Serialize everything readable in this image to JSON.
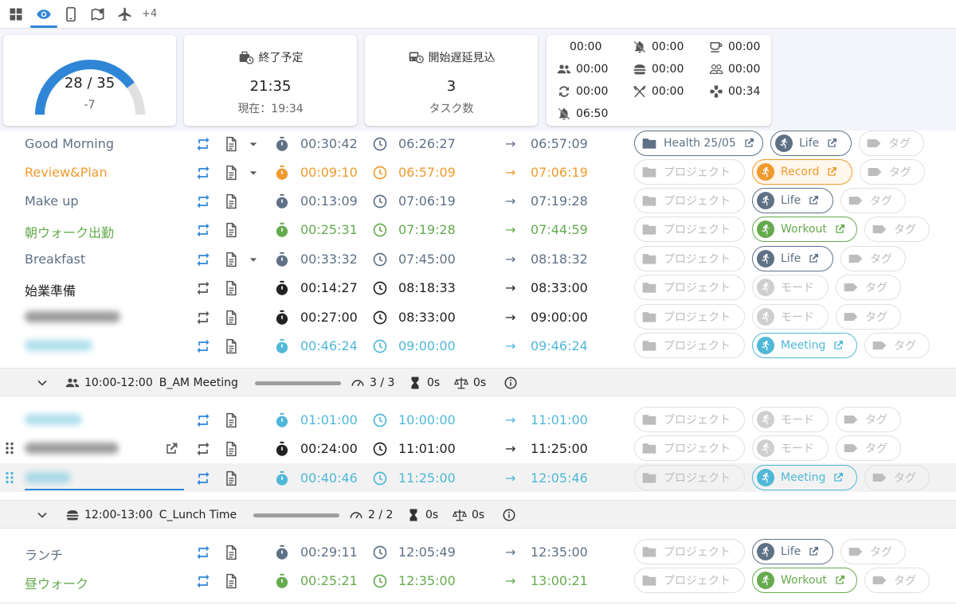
{
  "tabs": {
    "icons": [
      "grid-icon",
      "eye-icon",
      "phone-icon",
      "map-icon",
      "airplane-icon"
    ],
    "more_label": "+4"
  },
  "summary": {
    "gauge": {
      "main": "28 / 35",
      "sub": "-7",
      "progress": 0.8
    },
    "end_forecast": {
      "title": "終了予定",
      "value": "21:35",
      "sub": "現在：19:34"
    },
    "delay_forecast": {
      "title": "開始遅延見込",
      "value": "3",
      "sub": "タスク数"
    },
    "modes": [
      {
        "icon": "none",
        "value": "00:00"
      },
      {
        "icon": "notification-off-icon",
        "value": "00:00"
      },
      {
        "icon": "coffee-icon",
        "value": "00:00"
      },
      {
        "icon": "people-icon",
        "value": "00:00"
      },
      {
        "icon": "burger-icon",
        "value": "00:00"
      },
      {
        "icon": "people-outline-icon",
        "value": "00:00"
      },
      {
        "icon": "switch-icon",
        "value": "00:00"
      },
      {
        "icon": "cutlery-icon",
        "value": "00:00"
      },
      {
        "icon": "gamepad-icon",
        "value": "00:34"
      },
      {
        "icon": "notification-off-icon",
        "value": "06:50"
      }
    ]
  },
  "colors": {
    "blue": "#2f86d6",
    "slate": "#5f7185",
    "orange": "#f09a2e",
    "green": "#66aa4f",
    "cyan": "#4fb8d8",
    "dark": "#222222",
    "gray": "#616161"
  },
  "tasks_a": [
    {
      "name": "Good Morning",
      "color": "slate",
      "dropdown": true,
      "duration": "00:30:42",
      "start": "06:26:27",
      "end": "06:57:09",
      "project": "Health 25/05",
      "project_active": true,
      "mode": "Life",
      "mode_color": "slate",
      "mode_active": true,
      "tag": "タグ"
    },
    {
      "name": "Review&Plan",
      "color": "orange",
      "dropdown": true,
      "duration": "00:09:10",
      "start": "06:57:09",
      "end": "07:06:19",
      "project": "プロジェクト",
      "project_active": false,
      "mode": "Record",
      "mode_color": "orange",
      "mode_active": true,
      "tag": "タグ"
    },
    {
      "name": "Make up",
      "color": "slate",
      "dropdown": false,
      "duration": "00:13:09",
      "start": "07:06:19",
      "end": "07:19:28",
      "project": "プロジェクト",
      "project_active": false,
      "mode": "Life",
      "mode_color": "slate",
      "mode_active": true,
      "tag": "タグ"
    },
    {
      "name": "朝ウォーク出勤",
      "color": "green",
      "dropdown": false,
      "duration": "00:25:31",
      "start": "07:19:28",
      "end": "07:44:59",
      "project": "プロジェクト",
      "project_active": false,
      "mode": "Workout",
      "mode_color": "green",
      "mode_active": true,
      "tag": "タグ"
    },
    {
      "name": "Breakfast",
      "color": "slate",
      "dropdown": true,
      "duration": "00:33:32",
      "start": "07:45:00",
      "end": "08:18:32",
      "project": "プロジェクト",
      "project_active": false,
      "mode": "Life",
      "mode_color": "slate",
      "mode_active": true,
      "tag": "タグ"
    },
    {
      "name": "始業準備",
      "color": "dark",
      "dropdown": false,
      "duration": "00:14:27",
      "start": "08:18:33",
      "end": "08:33:00",
      "project": "プロジェクト",
      "project_active": false,
      "mode": "モード",
      "mode_color": "gray",
      "mode_active": false,
      "tag": "タグ"
    },
    {
      "name": "",
      "color": "dark",
      "dropdown": false,
      "duration": "00:27:00",
      "start": "08:33:00",
      "end": "09:00:00",
      "project": "プロジェクト",
      "project_active": false,
      "mode": "モード",
      "mode_color": "gray",
      "mode_active": false,
      "tag": "タグ"
    },
    {
      "name": "",
      "color": "cyan",
      "dropdown": false,
      "duration": "00:46:24",
      "start": "09:00:00",
      "end": "09:46:24",
      "project": "プロジェクト",
      "project_active": false,
      "mode": "Meeting",
      "mode_color": "cyan",
      "mode_active": true,
      "tag": "タグ"
    }
  ],
  "group_am": {
    "range": "10:00-12:00",
    "name": "B_AM Meeting",
    "count": "3 / 3",
    "estimate": "0s",
    "balance": "0s"
  },
  "tasks_b": [
    {
      "name": "",
      "color": "cyan",
      "duration": "01:01:00",
      "start": "10:00:00",
      "end": "11:01:00",
      "project": "プロジェクト",
      "mode": "モード",
      "mode_color": "gray",
      "mode_active": false,
      "tag": "タグ"
    },
    {
      "name": "",
      "color": "dark",
      "duration": "00:24:00",
      "start": "11:01:00",
      "end": "11:25:00",
      "project": "プロジェクト",
      "mode": "モード",
      "mode_color": "gray",
      "mode_active": false,
      "tag": "タグ"
    },
    {
      "name": "",
      "color": "cyan",
      "duration": "00:40:46",
      "start": "11:25:00",
      "end": "12:05:46",
      "project": "プロジェクト",
      "mode": "Meeting",
      "mode_color": "cyan",
      "mode_active": true,
      "tag": "タグ"
    }
  ],
  "group_lunch": {
    "range": "12:00-13:00",
    "name": "C_Lunch Time",
    "count": "2 / 2",
    "estimate": "0s",
    "balance": "0s"
  },
  "tasks_c": [
    {
      "name": "ランチ",
      "color": "slate",
      "duration": "00:29:11",
      "start": "12:05:49",
      "end": "12:35:00",
      "project": "プロジェクト",
      "mode": "Life",
      "mode_color": "slate",
      "mode_active": true,
      "tag": "タグ"
    },
    {
      "name": "昼ウォーク",
      "color": "green",
      "duration": "00:25:21",
      "start": "12:35:00",
      "end": "13:00:21",
      "project": "プロジェクト",
      "mode": "Workout",
      "mode_color": "green",
      "mode_active": true,
      "tag": "タグ"
    }
  ]
}
